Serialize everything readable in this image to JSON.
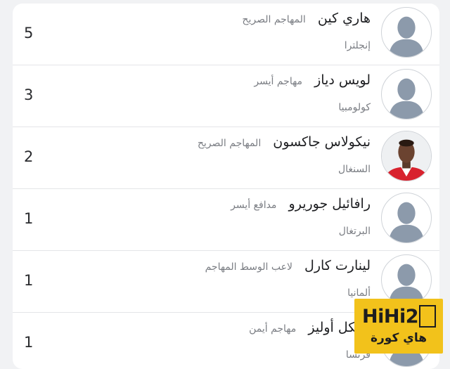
{
  "players": [
    {
      "name": "هاري كين",
      "position": "المهاجم الصريح",
      "country": "إنجلترا",
      "goals": "5",
      "avatar": "placeholder-silhouette"
    },
    {
      "name": "لويس دياز",
      "position": "مهاجم أيسر",
      "country": "كولومبيا",
      "goals": "3",
      "avatar": "placeholder-silhouette"
    },
    {
      "name": "نيكولاس جاكسون",
      "position": "المهاجم الصريح",
      "country": "السنغال",
      "goals": "2",
      "avatar": "player-photo"
    },
    {
      "name": "رافائيل جوريرو",
      "position": "مدافع أيسر",
      "country": "البرتغال",
      "goals": "1",
      "avatar": "placeholder-silhouette"
    },
    {
      "name": "لينارت كارل",
      "position": "لاعب الوسط المهاجم",
      "country": "ألمانيا",
      "goals": "1",
      "avatar": "placeholder-silhouette"
    },
    {
      "name": "مايكل أوليز",
      "position": "مهاجم أيمن",
      "country": "فرنسا",
      "goals": "1",
      "avatar": "placeholder-silhouette"
    }
  ],
  "watermark": {
    "line1": "HiHi2",
    "line2": "هاي كورة"
  },
  "colors": {
    "background": "#f1f2f4",
    "card": "#ffffff",
    "silhouette": "#8c9aab",
    "watermark": "#f2c21b"
  }
}
